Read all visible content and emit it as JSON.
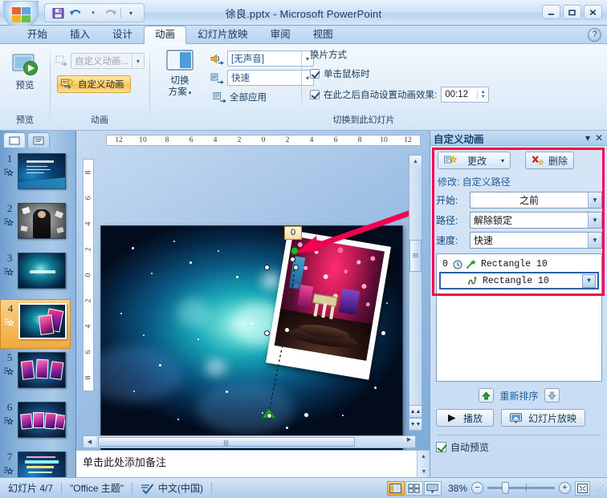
{
  "window": {
    "title": "徐良.pptx - Microsoft PowerPoint",
    "minimize": "—",
    "maximize": "▫",
    "close": "✕"
  },
  "quick_access": {
    "save": "save-icon",
    "undo": "undo-icon",
    "redo": "redo-icon",
    "more": "▾"
  },
  "help": {
    "label": "?"
  },
  "tabs": [
    {
      "label": "开始",
      "active": false
    },
    {
      "label": "插入",
      "active": false
    },
    {
      "label": "设计",
      "active": false
    },
    {
      "label": "动画",
      "active": true
    },
    {
      "label": "幻灯片放映",
      "active": false
    },
    {
      "label": "审阅",
      "active": false
    },
    {
      "label": "视图",
      "active": false
    }
  ],
  "ribbon": {
    "preview_group": {
      "label": "预览",
      "button": "预览"
    },
    "animation_group": {
      "label": "动画",
      "combo_value": "自定义动画...",
      "custom_animation_button": "自定义动画"
    },
    "transition_group": {
      "label": "切换到此幻灯片",
      "scheme_label_1": "切换",
      "scheme_label_2": "方案",
      "sound_value": "[无声音]",
      "speed_value": "快速",
      "apply_all": "全部应用",
      "advance_title": "换片方式",
      "on_click": "单击鼠标时",
      "after_auto": "在此之后自动设置动画效果:",
      "after_time": "00:12"
    }
  },
  "slide_pane": {
    "tab_slides": "slides-tab",
    "tab_outline": "outline-tab",
    "slides": [
      {
        "number": "1",
        "selected": false
      },
      {
        "number": "2",
        "selected": false
      },
      {
        "number": "3",
        "selected": false
      },
      {
        "number": "4",
        "selected": true
      },
      {
        "number": "5",
        "selected": false
      },
      {
        "number": "6",
        "selected": false
      },
      {
        "number": "7",
        "selected": false
      }
    ]
  },
  "editor": {
    "h_ruler": [
      "12",
      "10",
      "8",
      "6",
      "4",
      "2",
      "0",
      "2",
      "4",
      "6",
      "8",
      "10",
      "12"
    ],
    "v_ruler": [
      "8",
      "6",
      "4",
      "2",
      "0",
      "2",
      "4",
      "6",
      "8"
    ],
    "motion_path_tag": "0",
    "notes_placeholder": "单击此处添加备注"
  },
  "task_pane": {
    "title": "自定义动画",
    "dropdown_caret": "▾",
    "close": "✕",
    "change_button": "更改",
    "change_caret": "▾",
    "delete_button": "删除",
    "modify_label": "修改: 自定义路径",
    "fields": [
      {
        "label": "开始:",
        "value": "之前",
        "center": true
      },
      {
        "label": "路径:",
        "value": "解除锁定",
        "center": false
      },
      {
        "label": "速度:",
        "value": "快速",
        "center": false
      }
    ],
    "animations": [
      {
        "index": "0",
        "clock": "🕐",
        "icon": "star-burst-icon",
        "name": "Rectangle 10",
        "selected": false
      },
      {
        "index": "",
        "clock": "",
        "icon": "motion-path-icon",
        "name": "Rectangle 10",
        "selected": true
      }
    ],
    "reorder_label": "重新排序",
    "reorder_up": "▲",
    "reorder_down": "▼",
    "play_button": "播放",
    "slideshow_button": "幻灯片放映",
    "autopreview": "自动预览"
  },
  "status_bar": {
    "slide_counter": "幻灯片 4/7",
    "theme": "\"Office 主题\"",
    "language": "中文(中国)",
    "view_normal": "normal-view-icon",
    "view_sorter": "slide-sorter-icon",
    "view_show": "slideshow-view-icon",
    "zoom_level": "38%",
    "zoom_out": "−",
    "zoom_in": "+",
    "fit_window": "fit-to-window-icon"
  },
  "colors": {
    "accent_orange": "#f0a93c",
    "annotation_red": "#f5004f",
    "titlebar_blue": "#1f3b63",
    "link_blue": "#1f5fa0"
  }
}
